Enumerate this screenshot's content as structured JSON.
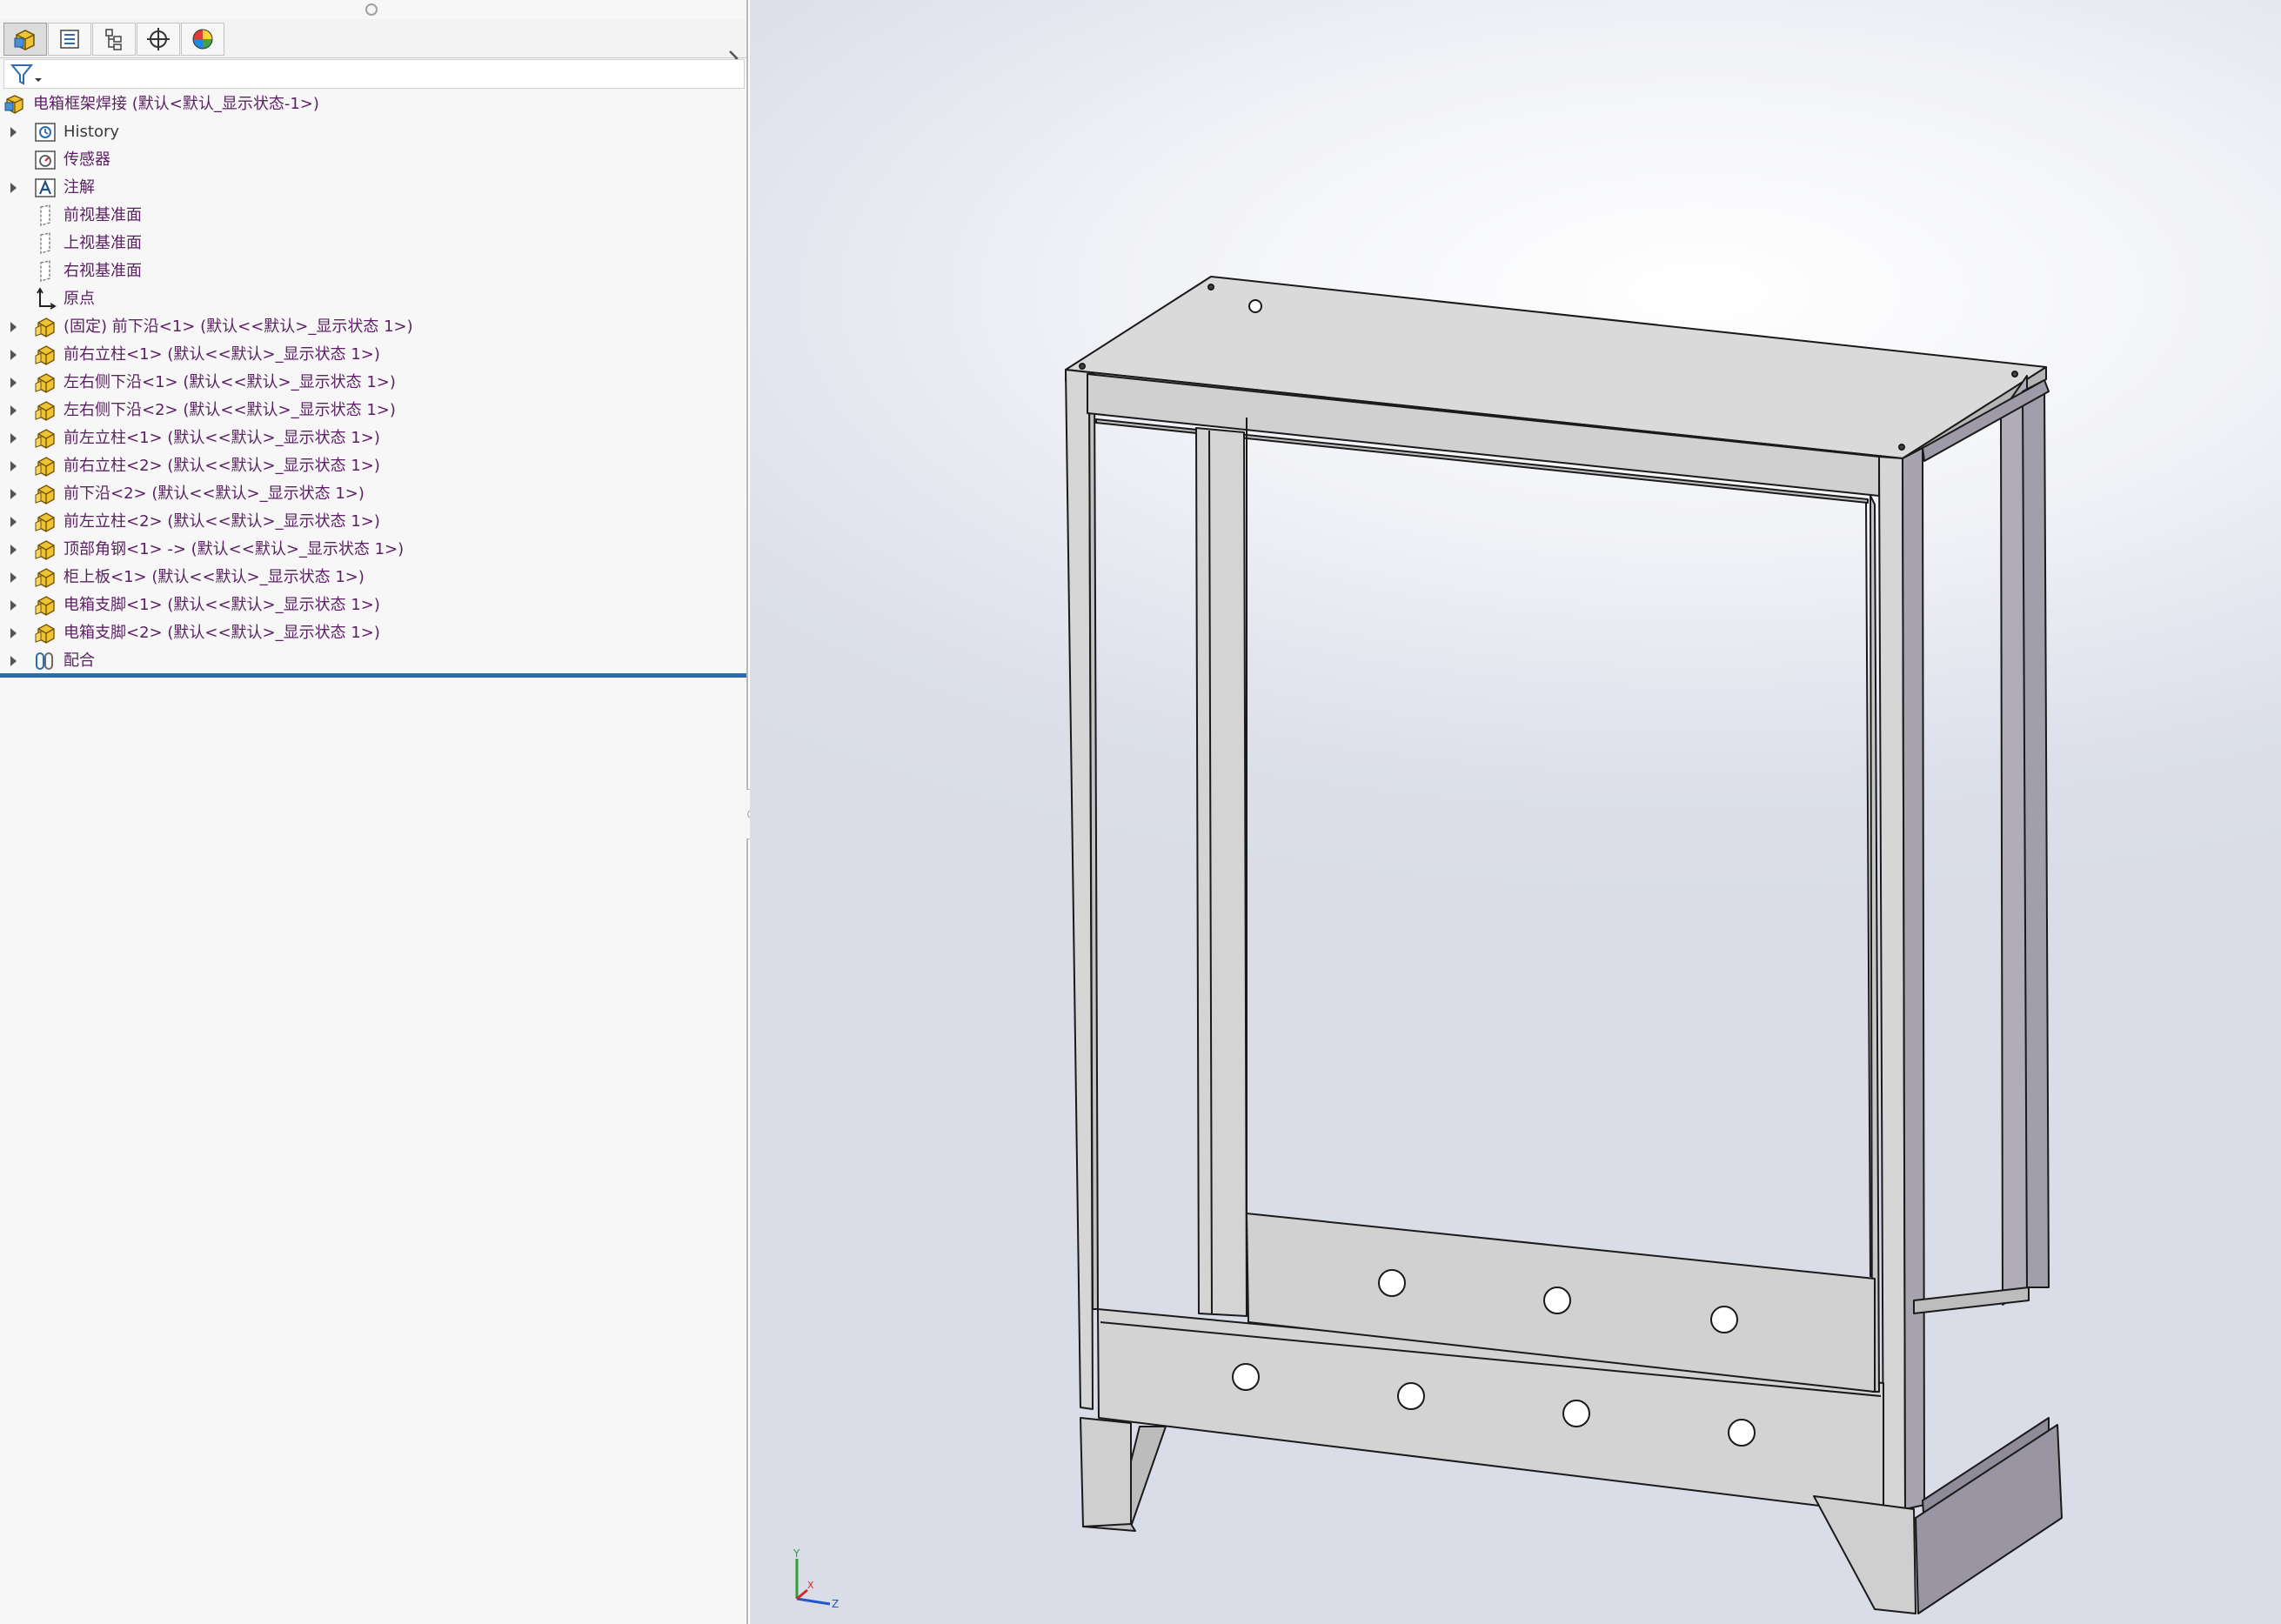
{
  "feature_tree": {
    "root": {
      "label": "电箱框架焊接  (默认<默认_显示状态-1>)",
      "icon": "assembly-icon"
    },
    "items": [
      {
        "label": "History",
        "icon": "history-icon",
        "expandable": true,
        "style": "dark"
      },
      {
        "label": "传感器",
        "icon": "sensor-icon",
        "expandable": false,
        "style": "normal"
      },
      {
        "label": "注解",
        "icon": "annotations-icon",
        "expandable": true,
        "style": "normal"
      },
      {
        "label": "前视基准面",
        "icon": "plane-icon",
        "expandable": false,
        "style": "normal"
      },
      {
        "label": "上视基准面",
        "icon": "plane-icon",
        "expandable": false,
        "style": "normal"
      },
      {
        "label": "右视基准面",
        "icon": "plane-icon",
        "expandable": false,
        "style": "normal"
      },
      {
        "label": "原点",
        "icon": "origin-icon",
        "expandable": false,
        "style": "normal"
      },
      {
        "label": "(固定) 前下沿<1> (默认<<默认>_显示状态 1>)",
        "icon": "part-icon",
        "expandable": true,
        "style": "normal"
      },
      {
        "label": "前右立柱<1> (默认<<默认>_显示状态 1>)",
        "icon": "part-icon",
        "expandable": true,
        "style": "normal"
      },
      {
        "label": "左右侧下沿<1> (默认<<默认>_显示状态 1>)",
        "icon": "part-icon",
        "expandable": true,
        "style": "normal"
      },
      {
        "label": "左右侧下沿<2> (默认<<默认>_显示状态 1>)",
        "icon": "part-icon",
        "expandable": true,
        "style": "normal"
      },
      {
        "label": "前左立柱<1> (默认<<默认>_显示状态 1>)",
        "icon": "part-icon",
        "expandable": true,
        "style": "normal"
      },
      {
        "label": "前右立柱<2> (默认<<默认>_显示状态 1>)",
        "icon": "part-icon",
        "expandable": true,
        "style": "normal"
      },
      {
        "label": "前下沿<2> (默认<<默认>_显示状态 1>)",
        "icon": "part-icon",
        "expandable": true,
        "style": "normal"
      },
      {
        "label": "前左立柱<2> (默认<<默认>_显示状态 1>)",
        "icon": "part-icon",
        "expandable": true,
        "style": "normal"
      },
      {
        "label": "顶部角钢<1> -> (默认<<默认>_显示状态 1>)",
        "icon": "part-icon",
        "expandable": true,
        "style": "normal"
      },
      {
        "label": "柜上板<1> (默认<<默认>_显示状态 1>)",
        "icon": "part-icon",
        "expandable": true,
        "style": "normal"
      },
      {
        "label": "电箱支脚<1> (默认<<默认>_显示状态 1>)",
        "icon": "part-icon",
        "expandable": true,
        "style": "normal"
      },
      {
        "label": "电箱支脚<2> (默认<<默认>_显示状态 1>)",
        "icon": "part-icon",
        "expandable": true,
        "style": "normal"
      },
      {
        "label": "配合",
        "icon": "mates-icon",
        "expandable": true,
        "style": "normal"
      }
    ]
  },
  "tabs": [
    {
      "name": "featuremanager-tab",
      "icon": "featuremanager-icon",
      "active": true
    },
    {
      "name": "propertymanager-tab",
      "icon": "propertymanager-icon",
      "active": false
    },
    {
      "name": "configurationmanager-tab",
      "icon": "configurationmanager-icon",
      "active": false
    },
    {
      "name": "dimxpertmanager-tab",
      "icon": "dimxpert-icon",
      "active": false
    },
    {
      "name": "displaymanager-tab",
      "icon": "displaymanager-icon",
      "active": false
    }
  ],
  "triad": {
    "x": "X",
    "y": "Y",
    "z": "Z"
  },
  "colors": {
    "tree_text": "#5b1f63",
    "rollback_bar": "#2a6cb0",
    "part_icon": "#f1c232",
    "frame_edge": "#1a1a1a",
    "frame_face": "#d9d9d9"
  }
}
